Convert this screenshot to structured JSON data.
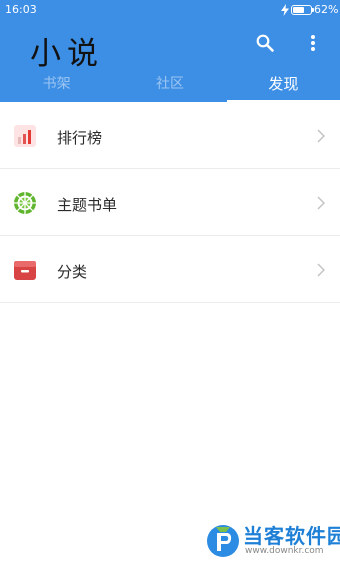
{
  "status_bar": {
    "time": "16:03",
    "battery": "62%",
    "battery_level": 0.62
  },
  "app_bar": {
    "title": "小说",
    "actions": [
      "search-icon",
      "more-vertical-icon"
    ]
  },
  "tabs": [
    {
      "label": "书架",
      "active": false
    },
    {
      "label": "社区",
      "active": false
    },
    {
      "label": "发现",
      "active": true
    }
  ],
  "discover_list": [
    {
      "label": "排行榜",
      "icon": "ranking-chart-icon"
    },
    {
      "label": "主题书单",
      "icon": "theme-booklist-icon"
    },
    {
      "label": "分类",
      "icon": "category-box-icon"
    }
  ],
  "watermark": {
    "name": "当客软件园",
    "url": "www.downkr.com"
  },
  "colors": {
    "primary": "#3d8ee5",
    "tab_inactive": "#9cc6f2",
    "divider": "#ececec",
    "watermark": "#1d7fd6"
  }
}
